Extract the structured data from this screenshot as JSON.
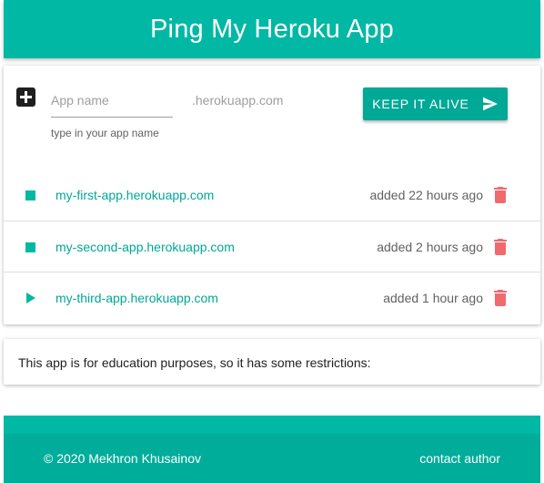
{
  "header": {
    "title": "Ping My Heroku App"
  },
  "add_form": {
    "icon": "add-box-icon",
    "input_placeholder": "App name",
    "input_value": "",
    "domain_suffix": ".herokuapp.com",
    "helper_text": "type in your app name",
    "submit_label": "Keep it alive",
    "submit_icon": "send-icon"
  },
  "apps": [
    {
      "status": "stop",
      "status_icon": "stop-icon",
      "url": "my-first-app.herokuapp.com",
      "added": "added 22 hours ago",
      "delete_icon": "trash-icon"
    },
    {
      "status": "stop",
      "status_icon": "stop-icon",
      "url": "my-second-app.herokuapp.com",
      "added": "added 2 hours ago",
      "delete_icon": "trash-icon"
    },
    {
      "status": "play",
      "status_icon": "play-icon",
      "url": "my-third-app.herokuapp.com",
      "added": "added 1 hour ago",
      "delete_icon": "trash-icon"
    }
  ],
  "info": {
    "text": "This app is for education purposes, so it has some restrictions:"
  },
  "footer": {
    "copyright": "© 2020 Mekhron Khusainov",
    "contact_label": "contact author"
  },
  "colors": {
    "primary": "#00b8a4",
    "button": "#00a896",
    "delete": "#f16a6e"
  }
}
